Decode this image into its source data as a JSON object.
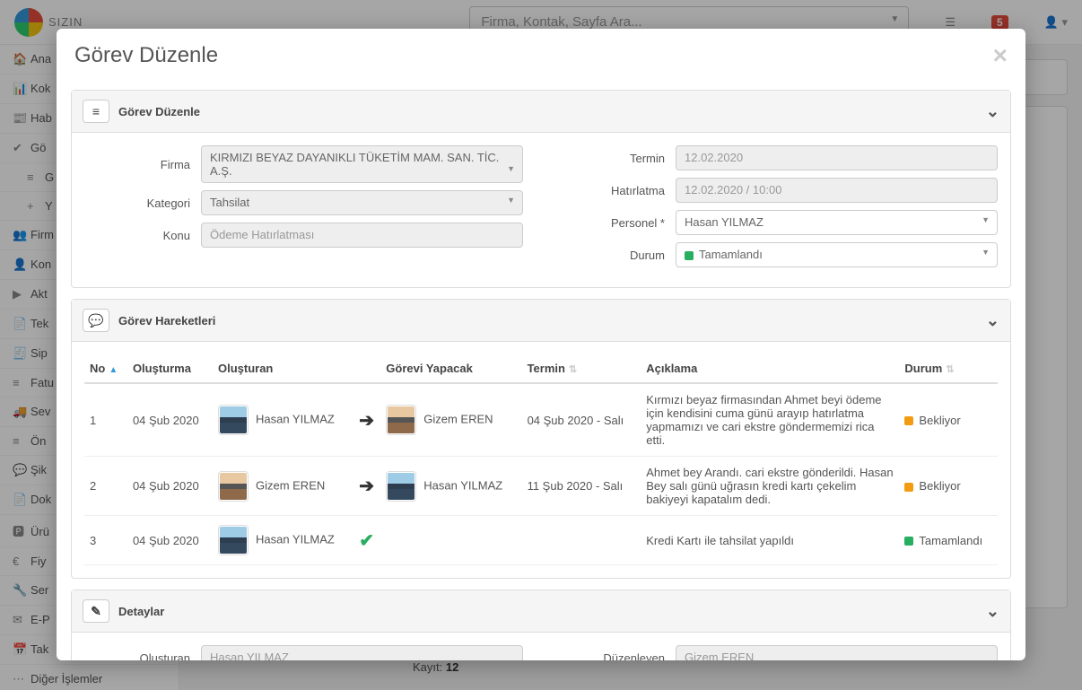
{
  "header": {
    "brand": "SIZIN",
    "search_placeholder": "Firma, Kontak, Sayfa Ara...",
    "notif_count": "5"
  },
  "sidebar": {
    "items": [
      {
        "icon": "🏠",
        "label": "Ana"
      },
      {
        "icon": "📊",
        "label": "Kok"
      },
      {
        "icon": "📰",
        "label": "Hab"
      },
      {
        "icon": "✔",
        "label": "Gö"
      },
      {
        "icon": "≡",
        "label": "G",
        "sub": true
      },
      {
        "icon": "+",
        "label": "Y",
        "sub": true
      },
      {
        "icon": "👥",
        "label": "Firm"
      },
      {
        "icon": "👤",
        "label": "Kon"
      },
      {
        "icon": "▶",
        "label": "Akt"
      },
      {
        "icon": "📄",
        "label": "Tek"
      },
      {
        "icon": "🧾",
        "label": "Sip"
      },
      {
        "icon": "≡",
        "label": "Fatu"
      },
      {
        "icon": "🚚",
        "label": "Sev"
      },
      {
        "icon": "≡",
        "label": "Ön"
      },
      {
        "icon": "💬",
        "label": "Şik"
      },
      {
        "icon": "📄",
        "label": "Dok"
      },
      {
        "icon": "🅿",
        "label": "Ürü"
      },
      {
        "icon": "€",
        "label": "Fiy"
      },
      {
        "icon": "🔧",
        "label": "Ser"
      },
      {
        "icon": "✉",
        "label": "E-P"
      },
      {
        "icon": "📅",
        "label": "Tak"
      },
      {
        "icon": "⋯",
        "label": "Diğer İşlemler"
      }
    ]
  },
  "modal": {
    "title": "Görev Düzenle",
    "panel1_title": "Görev Düzenle",
    "panel2_title": "Görev Hareketleri",
    "panel3_title": "Detaylar",
    "form": {
      "firma_label": "Firma",
      "firma_value": "KIRMIZI BEYAZ DAYANIKLI TÜKETİM MAM. SAN. TİC. A.Ş.",
      "kategori_label": "Kategori",
      "kategori_value": "Tahsilat",
      "konu_label": "Konu",
      "konu_placeholder": "Ödeme Hatırlatması",
      "termin_label": "Termin",
      "termin_value": "12.02.2020",
      "hatirlatma_label": "Hatırlatma",
      "hatirlatma_value": "12.02.2020 / 10:00",
      "personel_label": "Personel *",
      "personel_value": "Hasan YILMAZ",
      "durum_label": "Durum",
      "durum_value": "Tamamlandı"
    },
    "table": {
      "cols": {
        "no": "No",
        "olusturma": "Oluşturma",
        "olusturan": "Oluşturan",
        "gorevi": "Görevi Yapacak",
        "termin": "Termin",
        "aciklama": "Açıklama",
        "durum": "Durum"
      },
      "rows": [
        {
          "no": "1",
          "olusturma": "04 Şub 2020",
          "olusturan": "Hasan YILMAZ",
          "ol_av": "m",
          "gorevi": "Gizem EREN",
          "go_av": "f",
          "termin": "04 Şub 2020 - Salı",
          "aciklama": "Kırmızı beyaz firmasından Ahmet beyi ödeme için kendisini cuma günü arayıp hatırlatma yapmamızı ve cari ekstre göndermemizi rica etti.",
          "durum": "Bekliyor",
          "dot": "orange",
          "arrow": true
        },
        {
          "no": "2",
          "olusturma": "04 Şub 2020",
          "olusturan": "Gizem EREN",
          "ol_av": "f",
          "gorevi": "Hasan YILMAZ",
          "go_av": "m",
          "termin": "11 Şub 2020 - Salı",
          "aciklama": "Ahmet bey Arandı. cari ekstre gönderildi. Hasan Bey salı günü uğrasın kredi kartı çekelim bakiyeyi kapatalım dedi.",
          "durum": "Bekliyor",
          "dot": "orange",
          "arrow": true
        },
        {
          "no": "3",
          "olusturma": "04 Şub 2020",
          "olusturan": "Hasan YILMAZ",
          "ol_av": "m",
          "gorevi": "",
          "go_av": "",
          "termin": "",
          "aciklama": "Kredi Kartı ile tahsilat yapıldı",
          "durum": "Tamamlandı",
          "dot": "green",
          "check": true
        }
      ]
    },
    "details": {
      "olusturan_label": "Oluşturan",
      "olusturan_value": "Hasan YILMAZ",
      "duzenleyen_label": "Düzenleyen",
      "duzenleyen_value": "Gizem EREN"
    }
  },
  "footer": {
    "kayit_label": "Kayıt:",
    "kayit_value": "12"
  }
}
